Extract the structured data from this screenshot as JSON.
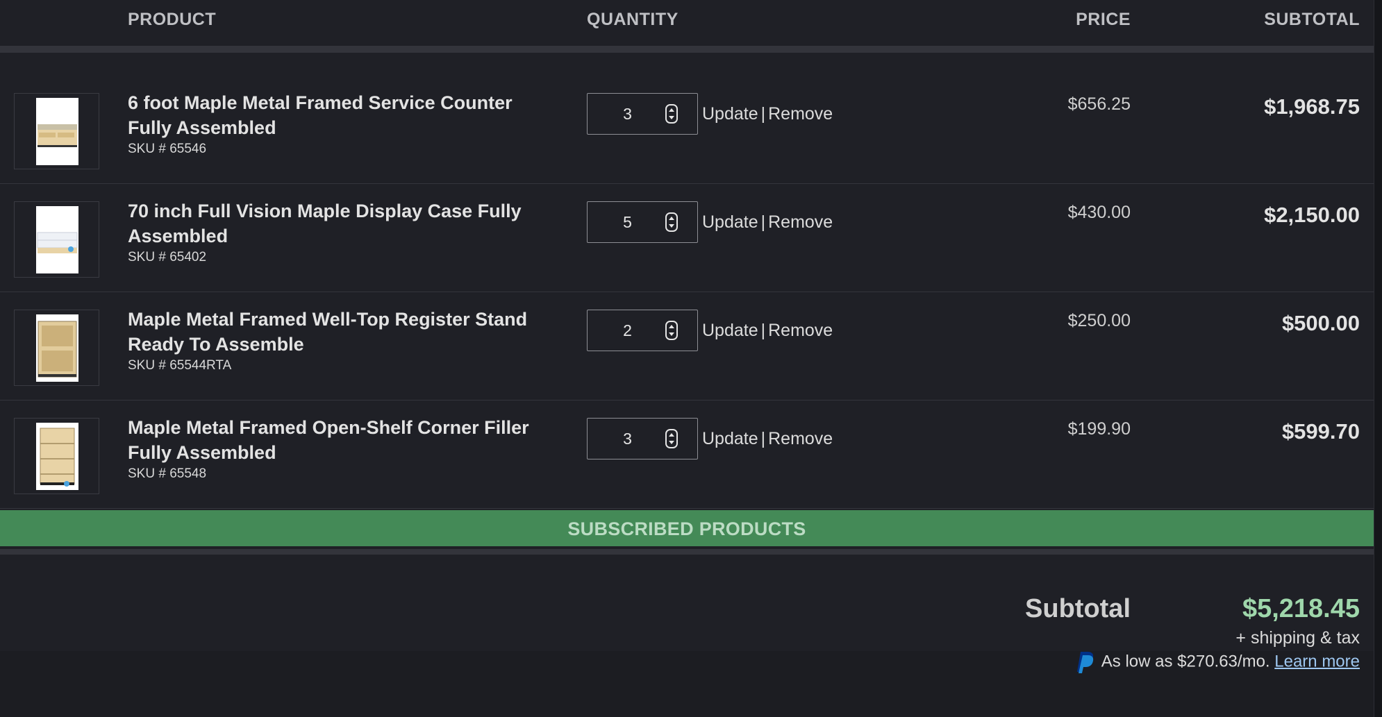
{
  "header": {
    "product": "PRODUCT",
    "quantity": "QUANTITY",
    "price": "PRICE",
    "subtotal": "SUBTOTAL"
  },
  "items": [
    {
      "name": "6 foot Maple Metal Framed Service Counter Fully Assembled",
      "sku": "SKU # 65546",
      "quantity": "3",
      "update": "Update",
      "remove": "Remove",
      "price": "$656.25",
      "subtotal": "$1,968.75"
    },
    {
      "name": "70 inch Full Vision Maple Display Case Fully Assembled",
      "sku": "SKU # 65402",
      "quantity": "5",
      "update": "Update",
      "remove": "Remove",
      "price": "$430.00",
      "subtotal": "$2,150.00"
    },
    {
      "name": "Maple Metal Framed Well-Top Register Stand Ready To Assemble",
      "sku": "SKU # 65544RTA",
      "quantity": "2",
      "update": "Update",
      "remove": "Remove",
      "price": "$250.00",
      "subtotal": "$500.00"
    },
    {
      "name": "Maple Metal Framed Open-Shelf Corner Filler Fully Assembled",
      "sku": "SKU # 65548",
      "quantity": "3",
      "update": "Update",
      "remove": "Remove",
      "price": "$199.90",
      "subtotal": "$599.70"
    }
  ],
  "subscribed_label": "SUBSCRIBED PRODUCTS",
  "totals": {
    "label": "Subtotal",
    "value": "$5,218.45",
    "shipping": "+ shipping & tax",
    "paypal_text": "As low as $270.63/mo.",
    "learn_more": "Learn more"
  },
  "icons": {
    "stepper": "up-down-stepper-icon",
    "paypal": "paypal-icon"
  },
  "colors": {
    "background": "#1f2026",
    "subscribed_bar": "#448a57",
    "total_value": "#9fd7ab",
    "link": "#9ec7f0"
  }
}
